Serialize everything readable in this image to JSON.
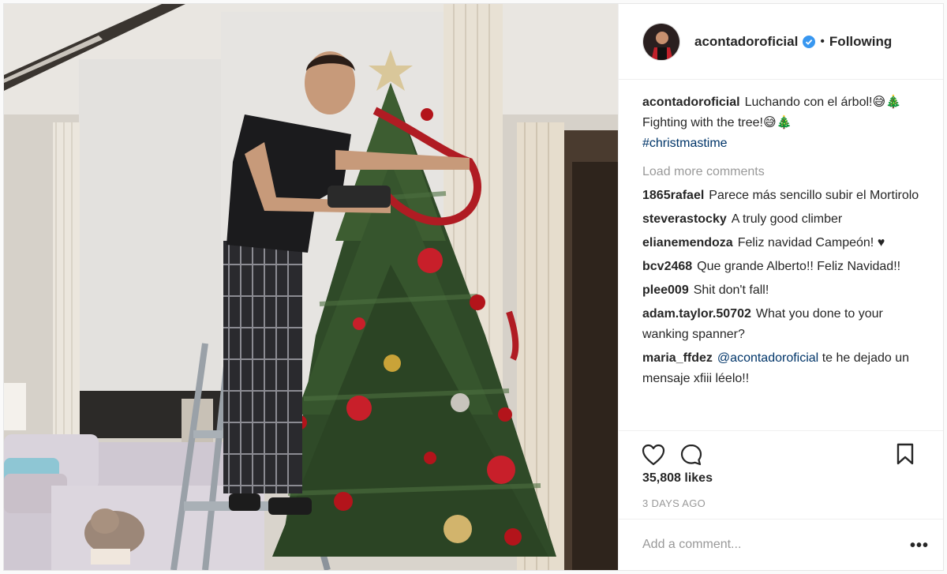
{
  "post": {
    "username": "acontadoroficial",
    "follow_status": "Following",
    "separator": "•",
    "caption": {
      "user": "acontadoroficial",
      "text": "Luchando con el árbol!😅🎄Fighting with the tree!😅🎄",
      "hashtag": "#christmastime"
    },
    "load_more": "Load more comments",
    "comments": [
      {
        "user": "1865rafael",
        "text": "Parece más sencillo subir el Mortirolo"
      },
      {
        "user": "steverastocky",
        "text": "A truly good climber"
      },
      {
        "user": "elianemendoza",
        "text": "Feliz navidad Campeón! ♥"
      },
      {
        "user": "bcv2468",
        "text": "Que grande Alberto!! Feliz Navidad!!"
      },
      {
        "user": "plee009",
        "text": "Shit don't fall!"
      },
      {
        "user": "adam.taylor.50702",
        "text": "What you done to your wanking spanner?"
      },
      {
        "user": "maria_ffdez",
        "mention": "@acontadoroficial",
        "text": "te he dejado un mensaje xfiii léelo!!"
      }
    ],
    "likes": "35,808 likes",
    "time_ago": "3 DAYS AGO",
    "comment_placeholder": "Add a comment...",
    "more_label": "•••"
  },
  "icons": {
    "like": "heart-icon",
    "comment": "comment-bubble-icon",
    "save": "bookmark-icon",
    "verified": "verified-badge-icon",
    "options": "more-options-icon"
  },
  "colors": {
    "verified_blue": "#3897f0",
    "link_blue": "#003569",
    "muted_gray": "#999999",
    "text": "#262626"
  }
}
